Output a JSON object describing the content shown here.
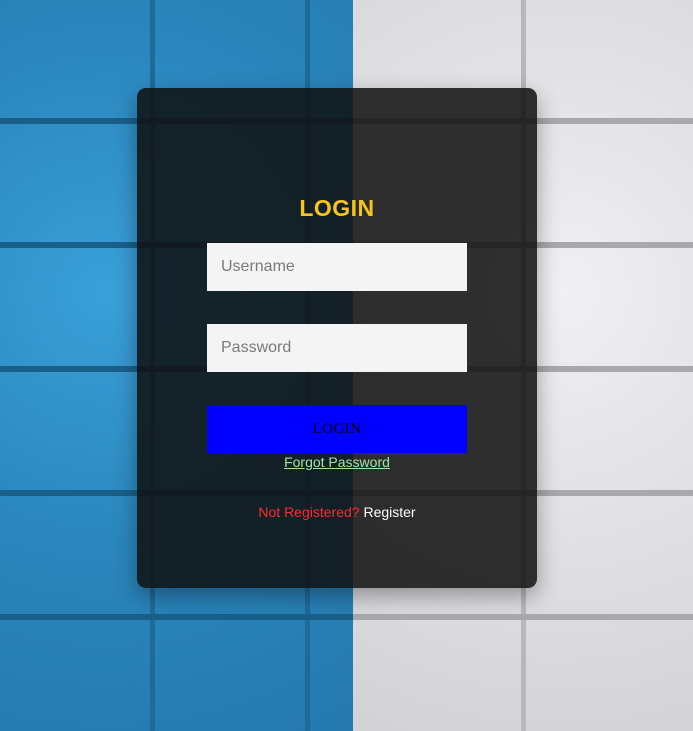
{
  "login": {
    "title": "LOGIN",
    "username_placeholder": "Username",
    "password_placeholder": "Password",
    "login_button_label": "LOGIN",
    "forgot_password_label": "Forgot Password",
    "not_registered_text": "Not Registered?",
    "register_label": "Register"
  },
  "colors": {
    "title": "#f7c51b",
    "login_button": "#0000ff",
    "forgot_link": "#9fe6a0",
    "not_registered": "#ff2a2a",
    "background_left": "#2d8fc7",
    "background_right": "#e6e6ea"
  }
}
